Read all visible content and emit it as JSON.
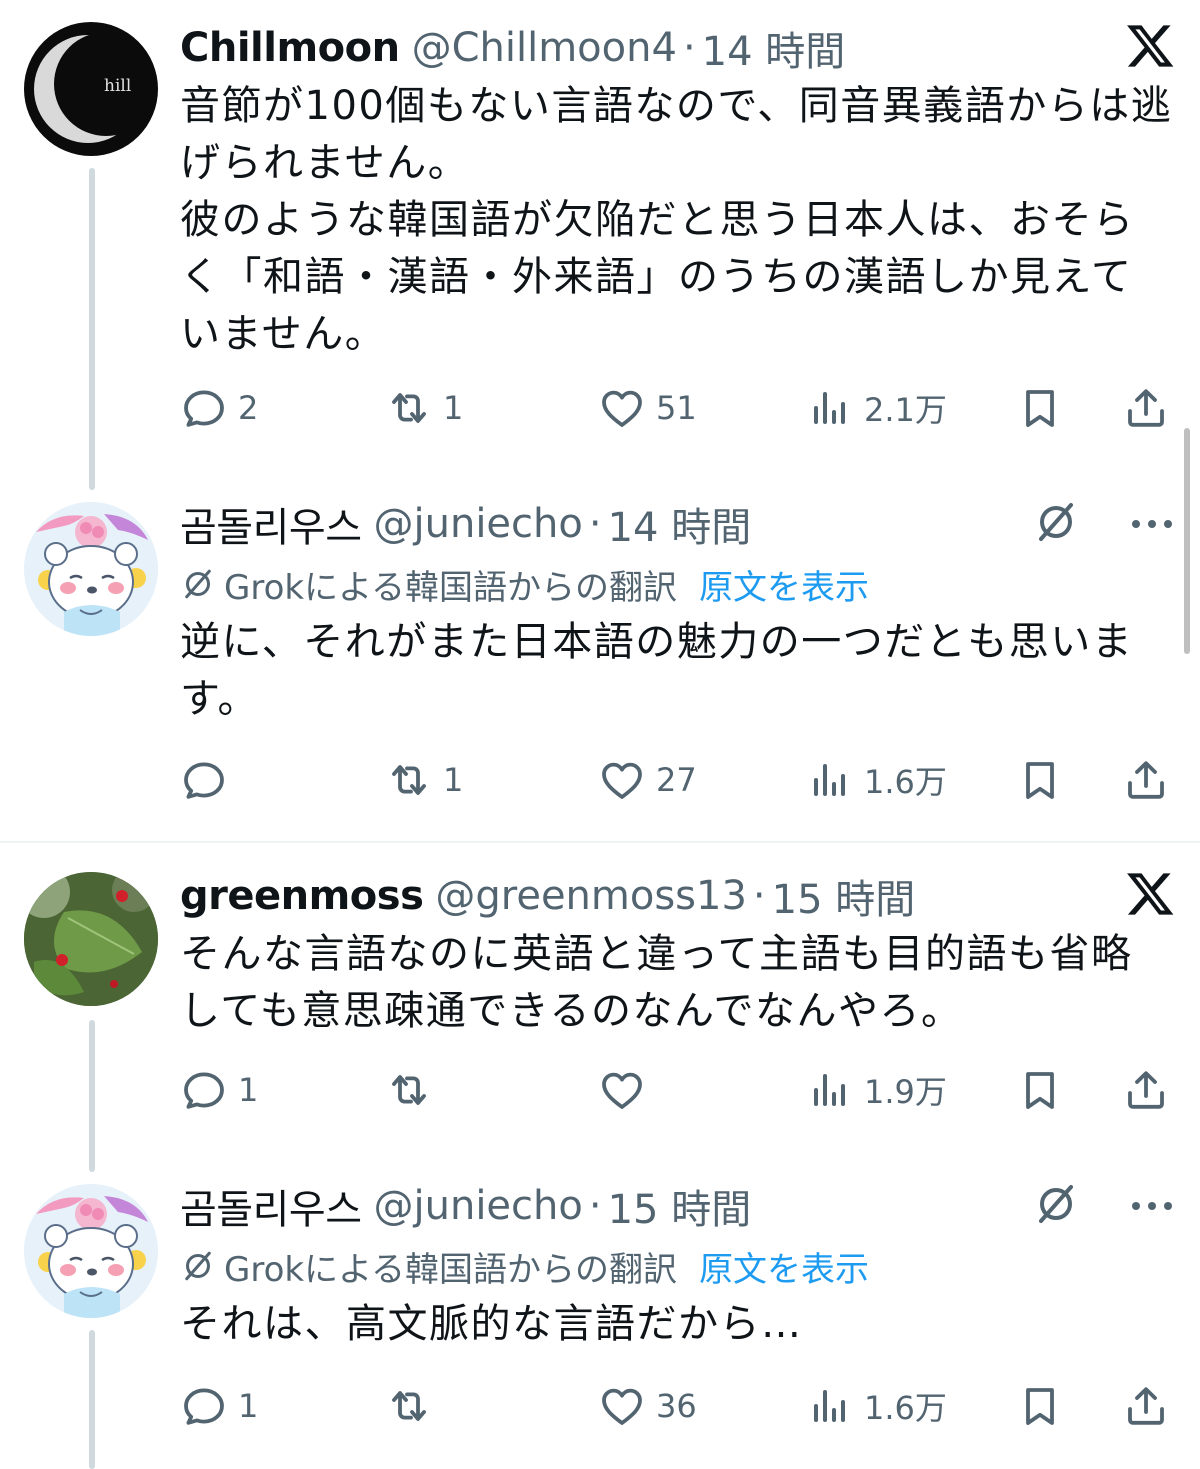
{
  "posts": [
    {
      "display_name": "Chillmoon",
      "handle": "@Chillmoon4",
      "separator": "·",
      "time": "14 時間",
      "avatar_text": "hill",
      "text": "音節が100個もない言語なので、同音異義語からは逃\nげられません。\n彼のような韓国語が欠陥だと思う日本人は、おそら\nく「和語・漢語・外来語」のうちの漢語しか見えて\nいません。",
      "replies": "2",
      "reposts": "1",
      "likes": "51",
      "views": "2.1万"
    },
    {
      "display_name": "곰돌리우스",
      "handle": "@juniecho",
      "separator": "·",
      "time": "14 時間",
      "translation_label": "Grokによる韓国語からの翻訳",
      "show_original": "原文を表示",
      "text": "逆に、それがまた日本語の魅力の一つだとも思いま\nす。",
      "replies": "",
      "reposts": "1",
      "likes": "27",
      "views": "1.6万"
    },
    {
      "display_name": "greenmoss",
      "handle": "@greenmoss13",
      "separator": "·",
      "time": "15 時間",
      "text": "そんな言語なのに英語と違って主語も目的語も省略\nしても意思疎通できるのなんでなんやろ。",
      "replies": "1",
      "reposts": "",
      "likes": "",
      "views": "1.9万"
    },
    {
      "display_name": "곰돌리우스",
      "handle": "@juniecho",
      "separator": "·",
      "time": "15 時間",
      "translation_label": "Grokによる韓国語からの翻訳",
      "show_original": "原文を表示",
      "text": "それは、高文脈的な言語だから…",
      "replies": "1",
      "reposts": "",
      "likes": "36",
      "views": "1.6万"
    }
  ],
  "icons": {
    "platform": "x-logo-icon",
    "reply": "reply-bubble-icon",
    "repost": "repost-arrows-icon",
    "like": "heart-icon",
    "views": "views-bars-icon",
    "bookmark": "bookmark-icon",
    "share": "share-upload-icon",
    "translate": "grok-translate-icon",
    "more": "more-dots-icon"
  },
  "colors": {
    "text": "#0f1419",
    "secondary": "#536471",
    "link": "#1d9bf0",
    "thread_line": "#cfd9de",
    "divider": "#eff3f4"
  }
}
